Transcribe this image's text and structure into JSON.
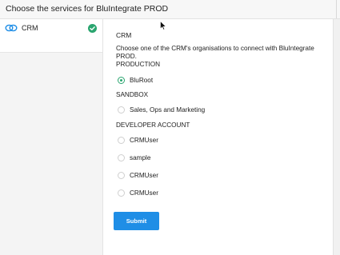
{
  "header": {
    "title": "Choose the services for BluIntegrate PROD"
  },
  "sidebar": {
    "items": [
      {
        "label": "CRM",
        "icon": "link-icon",
        "status_icon": "check-circle-icon",
        "status_color": "#2aa56f"
      }
    ]
  },
  "main": {
    "section_title": "CRM",
    "description": "Choose one of the CRM's organisations to connect with BluIntegrate PROD.",
    "groups": [
      {
        "label": "PRODUCTION",
        "options": [
          {
            "label": "BluRoot",
            "selected": true
          }
        ]
      },
      {
        "label": "SANDBOX",
        "options": [
          {
            "label": "Sales, Ops and Marketing",
            "selected": false
          }
        ]
      },
      {
        "label": "DEVELOPER ACCOUNT",
        "options": [
          {
            "label": "CRMUser",
            "selected": false
          },
          {
            "label": "sample",
            "selected": false
          },
          {
            "label": "CRMUser",
            "selected": false
          },
          {
            "label": "CRMUser",
            "selected": false
          }
        ]
      }
    ],
    "submit_label": "Submit"
  },
  "colors": {
    "accent": "#1f8ee6",
    "selected": "#2aa56f"
  }
}
